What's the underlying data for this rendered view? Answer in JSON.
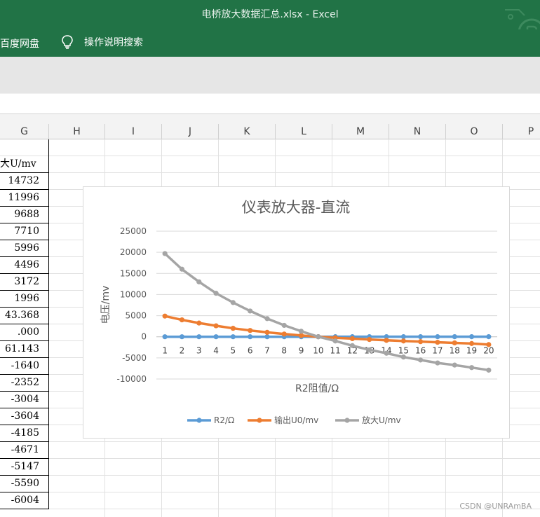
{
  "window": {
    "title": "电桥放大数据汇总.xlsx  -  Excel"
  },
  "ribbon": {
    "tab_baidu": "百度网盘",
    "tell_me": "操作说明搜索"
  },
  "columns": [
    "G",
    "H",
    "I",
    "J",
    "K",
    "L",
    "M",
    "N",
    "O",
    "P"
  ],
  "column_g_cells": [
    "大U/mv",
    "14732",
    "11996",
    "9688",
    "7710",
    "5996",
    "4496",
    "3172",
    "1996",
    "43.368",
    ".000",
    "61.143",
    "-1640",
    "-2352",
    "-3004",
    "-3604",
    "-4185",
    "-4671",
    "-5147",
    "-5590",
    "-6004"
  ],
  "watermark": "CSDN @UNRAmBA",
  "chart_data": {
    "type": "line",
    "title": "仪表放大器-直流",
    "xlabel": "R2阻值/Ω",
    "ylabel": "电压/mv",
    "categories": [
      "1",
      "2",
      "3",
      "4",
      "5",
      "6",
      "7",
      "8",
      "9",
      "10",
      "11",
      "12",
      "13",
      "14",
      "15",
      "16",
      "17",
      "18",
      "19",
      "20"
    ],
    "ylim": [
      -10000,
      25000
    ],
    "yticks": [
      "25000",
      "20000",
      "15000",
      "10000",
      "5000",
      "0",
      "-5000",
      "-10000"
    ],
    "grid": true,
    "legend": "bottom",
    "series": [
      {
        "name": "R2/Ω",
        "color": "#5b9bd5",
        "values": [
          1,
          2,
          3,
          4,
          5,
          6,
          7,
          8,
          9,
          10,
          11,
          12,
          13,
          14,
          15,
          16,
          17,
          18,
          19,
          20
        ]
      },
      {
        "name": "输出U0/mv",
        "color": "#ed7d31",
        "values": [
          4900,
          4000,
          3250,
          2600,
          2000,
          1500,
          1050,
          650,
          300,
          0,
          -250,
          -450,
          -650,
          -850,
          -1000,
          -1150,
          -1300,
          -1450,
          -1600,
          -1850
        ]
      },
      {
        "name": "放大U/mv",
        "color": "#a5a5a5",
        "values": [
          19700,
          16000,
          13000,
          10300,
          8100,
          6100,
          4300,
          2700,
          1300,
          0,
          -1000,
          -2100,
          -3100,
          -3900,
          -4800,
          -5500,
          -6200,
          -6700,
          -7300,
          -7900
        ]
      }
    ]
  }
}
